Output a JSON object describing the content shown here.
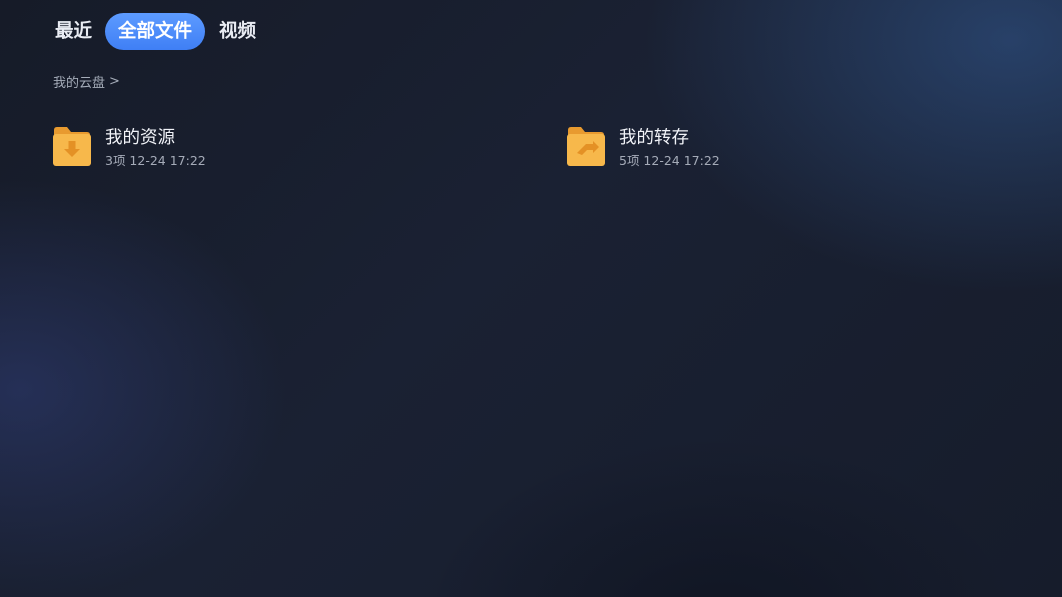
{
  "tabs": [
    {
      "label": "最近",
      "active": false
    },
    {
      "label": "全部文件",
      "active": true
    },
    {
      "label": "视频",
      "active": false
    }
  ],
  "breadcrumb": {
    "label": "我的云盘",
    "separator": ">"
  },
  "folders": [
    {
      "name": "我的资源",
      "info": "3项 12-24 17:22",
      "icon": "download-folder-icon"
    },
    {
      "name": "我的转存",
      "info": "5项 12-24 17:22",
      "icon": "transfer-folder-icon"
    }
  ],
  "colors": {
    "accent": "#4a8bff",
    "folder": "#f7b84b",
    "folder_dark": "#e89a2f",
    "background": "#171c2a"
  }
}
